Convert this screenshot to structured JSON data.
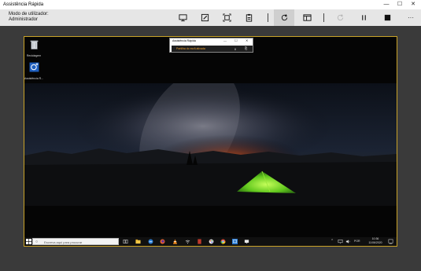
{
  "window": {
    "title": "Assistência Rápida",
    "controls": {
      "minimize": "—",
      "maximize": "☐",
      "close": "✕"
    }
  },
  "toolbar": {
    "mode_line1": "Modo de utilizador:",
    "mode_line2": "Administrador",
    "more": "···"
  },
  "remote": {
    "desktop_icons": [
      {
        "label": "Reciclagem",
        "icon": "recycle-bin-icon"
      },
      {
        "label": "Assistência R...",
        "icon": "quick-assist-icon"
      }
    ],
    "mini_window": {
      "title": "Assistência Rápida",
      "status": "Partilha do ecrã ativada",
      "pause": "II",
      "clipboard": "⎘"
    },
    "taskbar": {
      "search_placeholder": "Escreva aqui para procurar",
      "language": "POR",
      "time": "10:36",
      "date": "11/06/2020"
    }
  },
  "colors": {
    "accent_border": "#c9a227",
    "status_text": "#f0a030",
    "toolbar_bg": "#e6e6e6"
  }
}
